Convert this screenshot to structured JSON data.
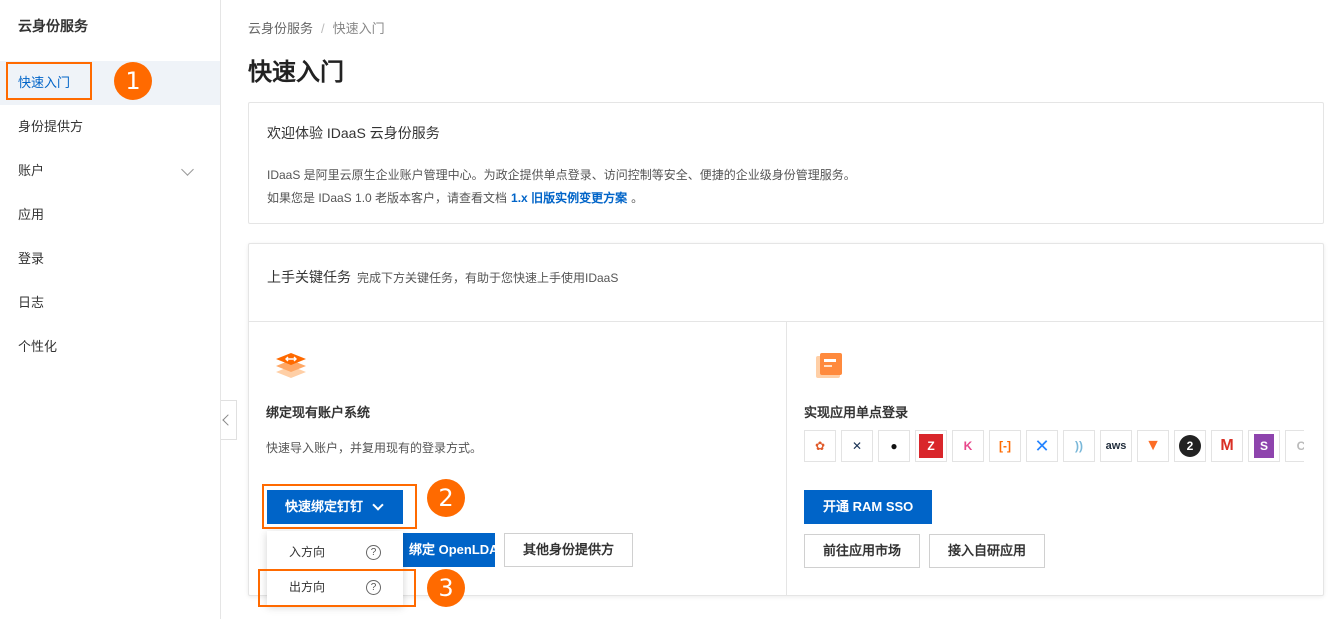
{
  "sidebar": {
    "title": "云身份服务",
    "items": [
      {
        "label": "快速入门"
      },
      {
        "label": "身份提供方"
      },
      {
        "label": "账户"
      },
      {
        "label": "应用"
      },
      {
        "label": "登录"
      },
      {
        "label": "日志"
      },
      {
        "label": "个性化"
      }
    ]
  },
  "breadcrumb": {
    "root": "云身份服务",
    "sep": "/",
    "current": "快速入门"
  },
  "page_title": "快速入门",
  "welcome": {
    "title": "欢迎体验 IDaaS 云身份服务",
    "desc": "IDaaS 是阿里云原生企业账户管理中心。为政企提供单点登录、访问控制等安全、便捷的企业级身份管理服务。",
    "doc_prefix": "如果您是 IDaaS 1.0 老版本客户，请查看文档",
    "doc_link": "1.x 旧版实例变更方案",
    "doc_suffix": "。"
  },
  "tasks": {
    "title": "上手关键任务",
    "subtitle": "完成下方关键任务，有助于您快速上手使用IDaaS",
    "left": {
      "title": "绑定现有账户系统",
      "desc": "快速导入账户，并复用现有的登录方式。",
      "dropdown_label": "快速绑定钉钉",
      "openldap_label": "绑定 OpenLDAP",
      "other_label": "其他身份提供方",
      "menu": [
        {
          "label": "入方向",
          "help": "?"
        },
        {
          "label": "出方向",
          "help": "?"
        }
      ]
    },
    "right": {
      "title": "实现应用单点登录",
      "ram_sso_label": "开通 RAM SSO",
      "market_label": "前往应用市场",
      "custom_label": "接入自研应用",
      "apps": [
        {
          "icon": "colorful-circles-app-icon",
          "glyph": "✿",
          "color": "#e05a2a"
        },
        {
          "icon": "jenkins-app-icon",
          "glyph": "✕",
          "color": "#1d3557"
        },
        {
          "icon": "github-app-icon",
          "glyph": "●",
          "color": "#111111"
        },
        {
          "icon": "zentao-app-icon",
          "glyph": "Z",
          "color": "#d9262b"
        },
        {
          "icon": "kibana-app-icon",
          "glyph": "K",
          "color": "#e8478b"
        },
        {
          "icon": "aliyun-app-icon",
          "glyph": "[-]",
          "color": "#ff6a00"
        },
        {
          "icon": "confluence-app-icon",
          "glyph": "✕",
          "color": "#2684ff"
        },
        {
          "icon": "wave-app-icon",
          "glyph": "))",
          "color": "#7ab8d9"
        },
        {
          "icon": "aws-app-icon",
          "glyph": "aws",
          "color": "#232f3e"
        },
        {
          "icon": "gitlab-app-icon",
          "glyph": "▼",
          "color": "#fc6d26"
        },
        {
          "icon": "number-two-app-icon",
          "glyph": "2",
          "color": "#222222"
        },
        {
          "icon": "gmail-app-icon",
          "glyph": "M",
          "color": "#d93025"
        },
        {
          "icon": "purple-s-app-icon",
          "glyph": "S",
          "color": "#8e44ad"
        },
        {
          "icon": "partial-app-icon",
          "glyph": "C",
          "color": "#bbbbbb"
        }
      ]
    }
  },
  "annotations": {
    "badge1": "1",
    "badge2": "2",
    "badge3": "3",
    "highlight_color": "#ff6a00"
  },
  "colors": {
    "primary": "#0064c8",
    "accent": "#ff6a00"
  }
}
